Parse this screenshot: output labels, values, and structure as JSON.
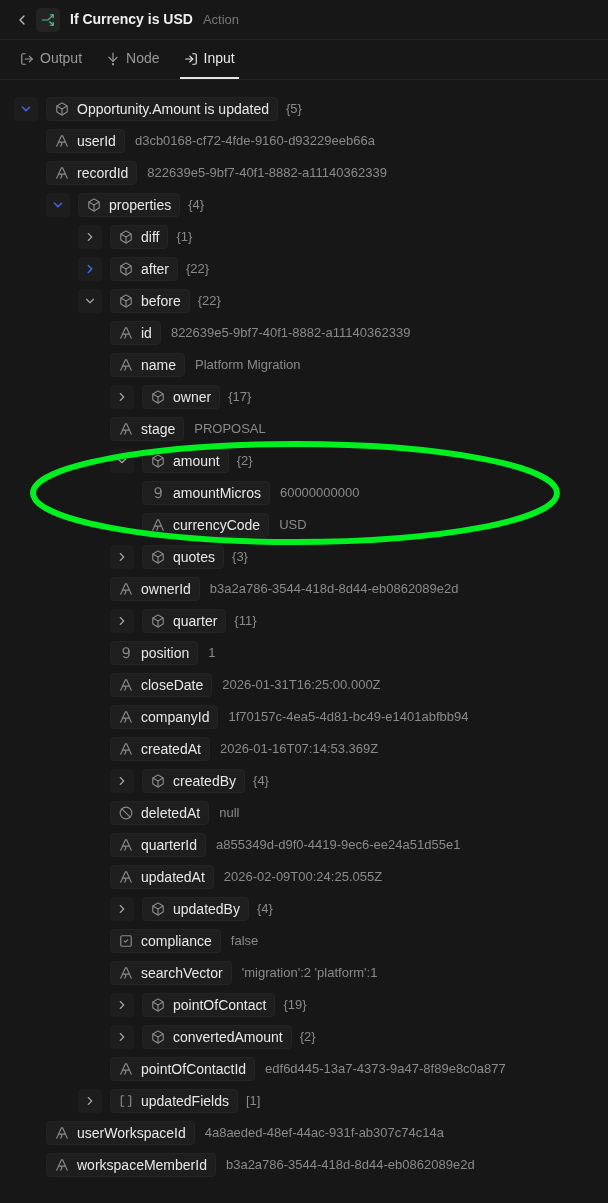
{
  "header": {
    "title": "If Currency is USD",
    "subtitle": "Action"
  },
  "tabs": [
    {
      "kind": "output",
      "label": "Output",
      "selected": false
    },
    {
      "kind": "node",
      "label": "Node",
      "selected": false
    },
    {
      "kind": "input",
      "label": "Input",
      "selected": true
    }
  ],
  "tree": [
    {
      "kind": "object",
      "label": "Opportunity.Amount is updated",
      "count": "{5}",
      "expanded": true,
      "highlighted": true,
      "children": [
        {
          "kind": "string",
          "label": "userId",
          "value": "d3cb0168-cf72-4fde-9160-d93229eeb66a"
        },
        {
          "kind": "string",
          "label": "recordId",
          "value": "822639e5-9bf7-40f1-8882-a11140362339"
        },
        {
          "kind": "object",
          "label": "properties",
          "count": "{4}",
          "expanded": true,
          "highlighted": true,
          "children": [
            {
              "kind": "object",
              "label": "diff",
              "count": "{1}",
              "expanded": false,
              "highlighted": false
            },
            {
              "kind": "object",
              "label": "after",
              "count": "{22}",
              "expanded": false,
              "highlighted": true
            },
            {
              "kind": "object",
              "label": "before",
              "count": "{22}",
              "expanded": true,
              "highlighted": false,
              "children": [
                {
                  "kind": "string",
                  "label": "id",
                  "value": "822639e5-9bf7-40f1-8882-a11140362339"
                },
                {
                  "kind": "string",
                  "label": "name",
                  "value": "Platform Migration"
                },
                {
                  "kind": "object",
                  "label": "owner",
                  "count": "{17}",
                  "expanded": false,
                  "highlighted": false
                },
                {
                  "kind": "string",
                  "label": "stage",
                  "value": "PROPOSAL"
                },
                {
                  "kind": "object",
                  "label": "amount",
                  "count": "{2}",
                  "expanded": true,
                  "highlighted": false,
                  "children": [
                    {
                      "kind": "number",
                      "label": "amountMicros",
                      "value": "60000000000"
                    },
                    {
                      "kind": "string",
                      "label": "currencyCode",
                      "value": "USD"
                    }
                  ]
                },
                {
                  "kind": "object",
                  "label": "quotes",
                  "count": "{3}",
                  "expanded": false,
                  "highlighted": false
                },
                {
                  "kind": "string",
                  "label": "ownerId",
                  "value": "b3a2a786-3544-418d-8d44-eb0862089e2d"
                },
                {
                  "kind": "object",
                  "label": "quarter",
                  "count": "{11}",
                  "expanded": false,
                  "highlighted": false
                },
                {
                  "kind": "number",
                  "label": "position",
                  "value": "1"
                },
                {
                  "kind": "string",
                  "label": "closeDate",
                  "value": "2026-01-31T16:25:00.000Z"
                },
                {
                  "kind": "string",
                  "label": "companyId",
                  "value": "1f70157c-4ea5-4d81-bc49-e1401abfbb94"
                },
                {
                  "kind": "string",
                  "label": "createdAt",
                  "value": "2026-01-16T07:14:53.369Z"
                },
                {
                  "kind": "object",
                  "label": "createdBy",
                  "count": "{4}",
                  "expanded": false,
                  "highlighted": false
                },
                {
                  "kind": "null",
                  "label": "deletedAt",
                  "value": "null"
                },
                {
                  "kind": "string",
                  "label": "quarterId",
                  "value": "a855349d-d9f0-4419-9ec6-ee24a51d55e1"
                },
                {
                  "kind": "string",
                  "label": "updatedAt",
                  "value": "2026-02-09T00:24:25.055Z"
                },
                {
                  "kind": "object",
                  "label": "updatedBy",
                  "count": "{4}",
                  "expanded": false,
                  "highlighted": false
                },
                {
                  "kind": "boolean",
                  "label": "compliance",
                  "value": "false"
                },
                {
                  "kind": "string",
                  "label": "searchVector",
                  "value": "'migration':2 'platform':1"
                },
                {
                  "kind": "object",
                  "label": "pointOfContact",
                  "count": "{19}",
                  "expanded": false,
                  "highlighted": false
                },
                {
                  "kind": "object",
                  "label": "convertedAmount",
                  "count": "{2}",
                  "expanded": false,
                  "highlighted": false
                },
                {
                  "kind": "string",
                  "label": "pointOfContactId",
                  "value": "edf6d445-13a7-4373-9a47-8f89e8c0a877"
                }
              ]
            },
            {
              "kind": "array",
              "label": "updatedFields",
              "count": "[1]",
              "expanded": false,
              "highlighted": false
            }
          ]
        },
        {
          "kind": "string",
          "label": "userWorkspaceId",
          "value": "4a8aeded-48ef-44ac-931f-ab307c74c14a"
        },
        {
          "kind": "string",
          "label": "workspaceMemberId",
          "value": "b3a2a786-3544-418d-8d44-eb0862089e2d"
        }
      ]
    }
  ],
  "annotation": {
    "kind": "ellipse"
  }
}
